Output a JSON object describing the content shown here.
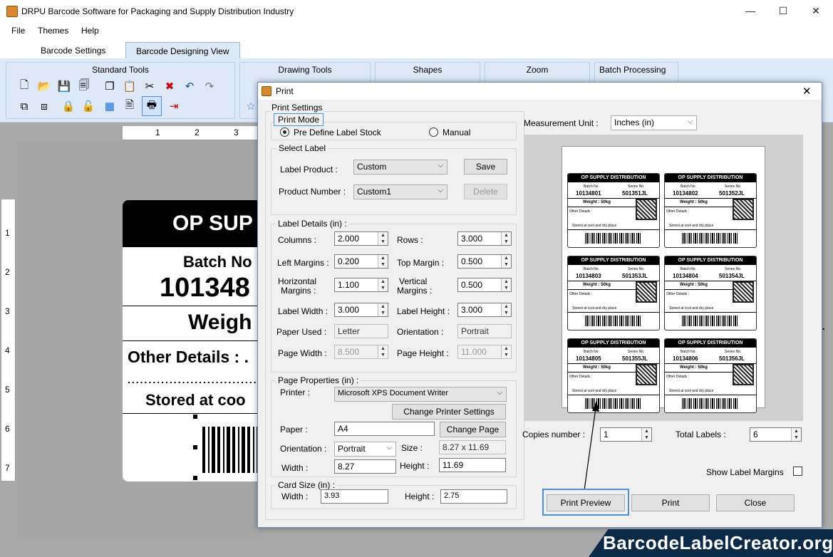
{
  "app": {
    "title": "DRPU Barcode Software for Packaging and Supply Distribution Industry"
  },
  "window_controls": {
    "minimize": "—",
    "maximize": "☐",
    "close": "✕"
  },
  "menu": [
    "File",
    "Themes",
    "Help"
  ],
  "tabs": [
    {
      "label": "Barcode Settings"
    },
    {
      "label": "Barcode Designing View"
    }
  ],
  "ribbon": {
    "groups": [
      "Standard Tools",
      "Drawing Tools",
      "Shapes",
      "Zoom",
      "Batch Processing"
    ]
  },
  "rulers": {
    "h": [
      "1",
      "2",
      "3"
    ],
    "v": [
      "1",
      "2",
      "3",
      "4",
      "5",
      "6",
      "7"
    ]
  },
  "canvas_label": {
    "header": "OP SUP",
    "batch": "Batch No",
    "batch_no": "101348",
    "weight": "Weigh",
    "other": "Other Details : .",
    "stored": "Stored at coo"
  },
  "dialog": {
    "title": "Print",
    "close": "✕",
    "print_settings": "Print Settings",
    "print_mode": {
      "label": "Print Mode",
      "options": [
        "Pre Define Label Stock",
        "Manual"
      ],
      "selected": "Pre Define Label Stock"
    },
    "select_label": {
      "label": "Select Label",
      "label_product_label": "Label Product :",
      "label_product_value": "Custom",
      "product_number_label": "Product Number :",
      "product_number_value": "Custom1",
      "save": "Save",
      "delete": "Delete"
    },
    "label_details": {
      "label": "Label Details (in) :",
      "columns_label": "Columns :",
      "columns": "2.000",
      "rows_label": "Rows :",
      "rows": "3.000",
      "left_margins_label": "Left Margins :",
      "left_margins": "0.200",
      "top_margin_label": "Top Margin :",
      "top_margin": "0.500",
      "h_margins_label1": "Horizontal",
      "h_margins_label2": "Margins :",
      "h_margins": "1.100",
      "v_margins_label1": "Vertical",
      "v_margins_label2": "Margins :",
      "v_margins": "0.500",
      "label_width_label": "Label Width :",
      "label_width": "3.000",
      "label_height_label": "Label Height :",
      "label_height": "3.000",
      "paper_used_label": "Paper Used :",
      "paper_used": "Letter",
      "orientation_label": "Orientation :",
      "orientation": "Portrait",
      "page_width_label": "Page Width :",
      "page_width": "8.500",
      "page_height_label": "Page Height :",
      "page_height": "11.000"
    },
    "page_properties": {
      "label": "Page Properties (in) :",
      "printer_label": "Printer :",
      "printer": "Microsoft XPS Document Writer",
      "change_printer": "Change Printer Settings",
      "paper_label": "Paper :",
      "paper": "A4",
      "change_page": "Change Page",
      "orientation_label": "Orientation :",
      "orientation": "Portrait",
      "size_label": "Size :",
      "size": "8.27 x 11.69",
      "width_label": "Width :",
      "width": "8.27",
      "height_label": "Height :",
      "height": "11.69"
    },
    "card_size": {
      "label": "Card Size (in) :",
      "width_label": "Width :",
      "width": "3.93",
      "height_label": "Height :",
      "height": "2.75"
    },
    "measurement_unit": {
      "label": "Measurement Unit :",
      "value": "Inches (in)"
    },
    "preview_labels": [
      {
        "header": "OP SUPPLY DISTRIBUTION",
        "batch_label": "Batch No.",
        "series_label": "Series No.",
        "batch": "10134801",
        "series": "501351JL",
        "weight": "Weight : 50kg",
        "other": "Other Details :",
        "stored": "Stored at cool and dry place"
      },
      {
        "header": "OP SUPPLY DISTRIBUTION",
        "batch_label": "Batch No.",
        "series_label": "Series No.",
        "batch": "10134802",
        "series": "501352JL",
        "weight": "Weight : 50kg",
        "other": "Other Details :",
        "stored": "Stored at cool and dry place"
      },
      {
        "header": "OP SUPPLY DISTRIBUTION",
        "batch_label": "Batch No.",
        "series_label": "Series No.",
        "batch": "10134803",
        "series": "501353JL",
        "weight": "Weight : 50kg",
        "other": "Other Details :",
        "stored": "Stored at cool and dry place"
      },
      {
        "header": "OP SUPPLY DISTRIBUTION",
        "batch_label": "Batch No.",
        "series_label": "Series No.",
        "batch": "10134804",
        "series": "501354JL",
        "weight": "Weight : 50kg",
        "other": "Other Details :",
        "stored": "Stored at cool and dry place"
      },
      {
        "header": "OP SUPPLY DISTRIBUTION",
        "batch_label": "Batch No.",
        "series_label": "Series No.",
        "batch": "10134805",
        "series": "501355JL",
        "weight": "Weight : 50kg",
        "other": "Other Details :",
        "stored": "Stored at cool and dry place"
      },
      {
        "header": "OP SUPPLY DISTRIBUTION",
        "batch_label": "Batch No.",
        "series_label": "Series No.",
        "batch": "10134806",
        "series": "501356JL",
        "weight": "Weight : 50kg",
        "other": "Other Details :",
        "stored": "Stored at cool and dry place"
      }
    ],
    "copies": {
      "label": "Copies number :",
      "value": "1"
    },
    "total_labels": {
      "label": "Total Labels :",
      "value": "6"
    },
    "show_margins": {
      "label": "Show Label Margins",
      "checked": false
    },
    "buttons": {
      "print_preview": "Print Preview",
      "print": "Print",
      "close": "Close"
    }
  },
  "right_fragment": "s.",
  "watermark": "BarcodeLabelCreator.org"
}
